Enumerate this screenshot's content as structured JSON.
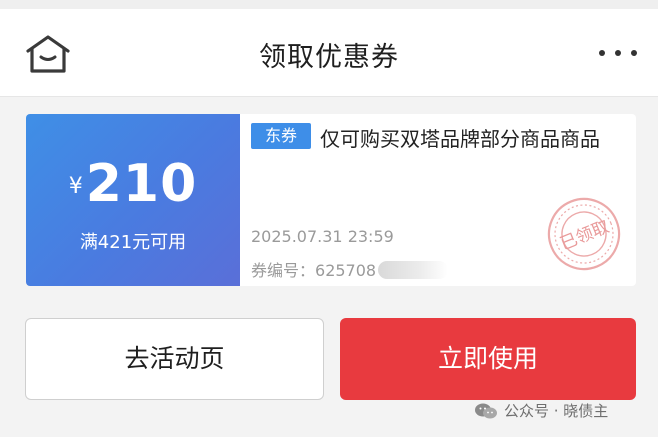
{
  "header": {
    "title": "领取优惠券",
    "home_icon": "home-icon",
    "more_icon": "more-dots-icon"
  },
  "coupon": {
    "currency": "¥",
    "amount": "210",
    "condition": "满421元可用",
    "tag": "东券",
    "description": "仅可购买双塔品牌部分商品商品",
    "expire": "2025.07.31 23:59",
    "code_label": "券编号：",
    "code_visible": "625708",
    "stamp_text": "已领取",
    "colors": {
      "left_start": "#3f8fe6",
      "left_end": "#5a6fd8",
      "tag_bg": "#3e8ee8",
      "stamp": "#e9a0a0"
    }
  },
  "actions": {
    "activity_label": "去活动页",
    "use_label": "立即使用",
    "use_color": "#e83a3f"
  },
  "watermark": {
    "text": "公众号 · 晓债主",
    "icon": "wechat-icon"
  }
}
